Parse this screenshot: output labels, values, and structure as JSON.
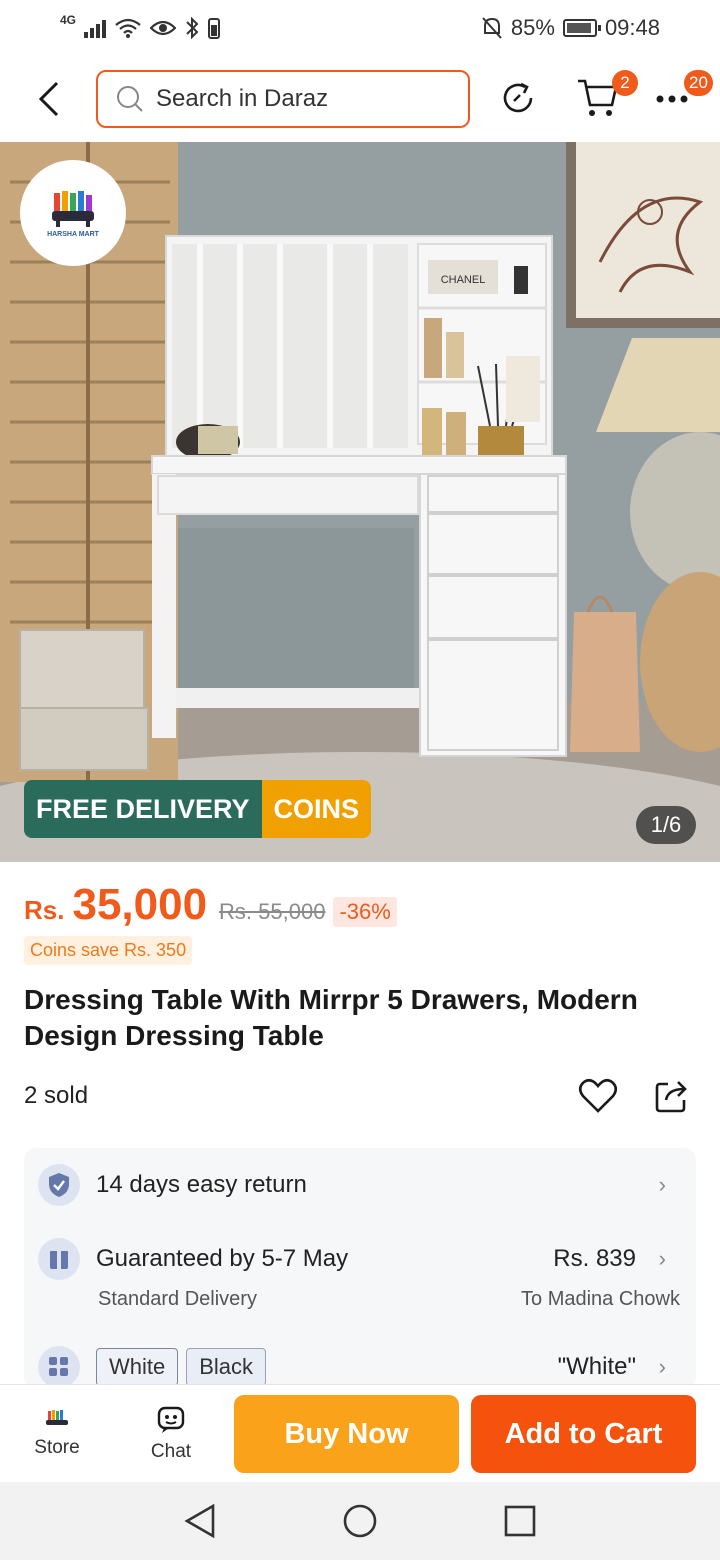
{
  "status_bar": {
    "network": "4G",
    "battery_pct": "85%",
    "time": "09:48"
  },
  "header": {
    "search_placeholder": "Search in Daraz",
    "cart_count": "2",
    "more_count": "20"
  },
  "hero": {
    "store_logo_text": "HARSHA MART",
    "free_delivery_label": "FREE DELIVERY",
    "coins_label": "COINS",
    "image_counter": "1/6",
    "product_brand_text": "CHANEL"
  },
  "product": {
    "currency": "Rs.",
    "price": "35,000",
    "old_price": "Rs. 55,000",
    "discount": "-36%",
    "coins_save": "Coins save Rs. 350",
    "title": "Dressing Table With Mirrpr 5 Drawers, Modern Design Dressing Table",
    "sold": "2 sold"
  },
  "info": {
    "return_text": "14 days easy return",
    "delivery_text": "Guaranteed by 5-7 May",
    "delivery_fee": "Rs. 839",
    "delivery_type": "Standard Delivery",
    "delivery_to": "To Madina Chowk",
    "variants": [
      "White",
      "Black"
    ],
    "selected_variant": "\"White\""
  },
  "bottom_bar": {
    "store_label": "Store",
    "chat_label": "Chat",
    "buy_now_label": "Buy Now",
    "add_to_cart_label": "Add to Cart"
  },
  "colors": {
    "accent": "#f05a1a",
    "buy_now": "#fba21b",
    "add_to_cart": "#f5520e",
    "free_delivery": "#2b6b5c",
    "coins": "#f0a000"
  }
}
